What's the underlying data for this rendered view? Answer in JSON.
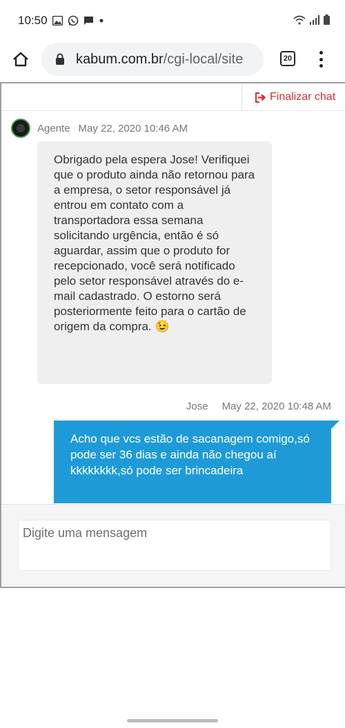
{
  "status_bar": {
    "time": "10:50"
  },
  "browser": {
    "url_domain": "kabum.com.br",
    "url_path": "/cgi-local/site",
    "tab_count": "20"
  },
  "chat": {
    "end_chat_label": "Finalizar chat",
    "messages": [
      {
        "sender": "Agente",
        "timestamp": "May 22, 2020 10:46 AM",
        "text": "Obrigado pela espera Jose! Verifiquei que o produto ainda não retornou para a empresa, o setor responsável já entrou em contato com a transportadora essa semana solicitando urgência, então é só aguardar, assim que o produto for recepcionado, você será notificado pelo setor responsável através do e-mail cadastrado. O estorno será posteriormente feito para o cartão de origem da compra. 😉"
      },
      {
        "sender": "Jose",
        "timestamp": "May 22, 2020 10:48 AM",
        "text": "Acho que vcs estão de sacanagem comigo,só pode ser 36 dias e ainda não chegou aí kkkkkkkk,só pode ser brincadeira"
      }
    ],
    "input_placeholder": "Digite uma mensagem"
  },
  "colors": {
    "accent_blue": "#1e9bd7",
    "end_chat_red": "#d32f2f",
    "agent_bubble": "#efefef"
  }
}
